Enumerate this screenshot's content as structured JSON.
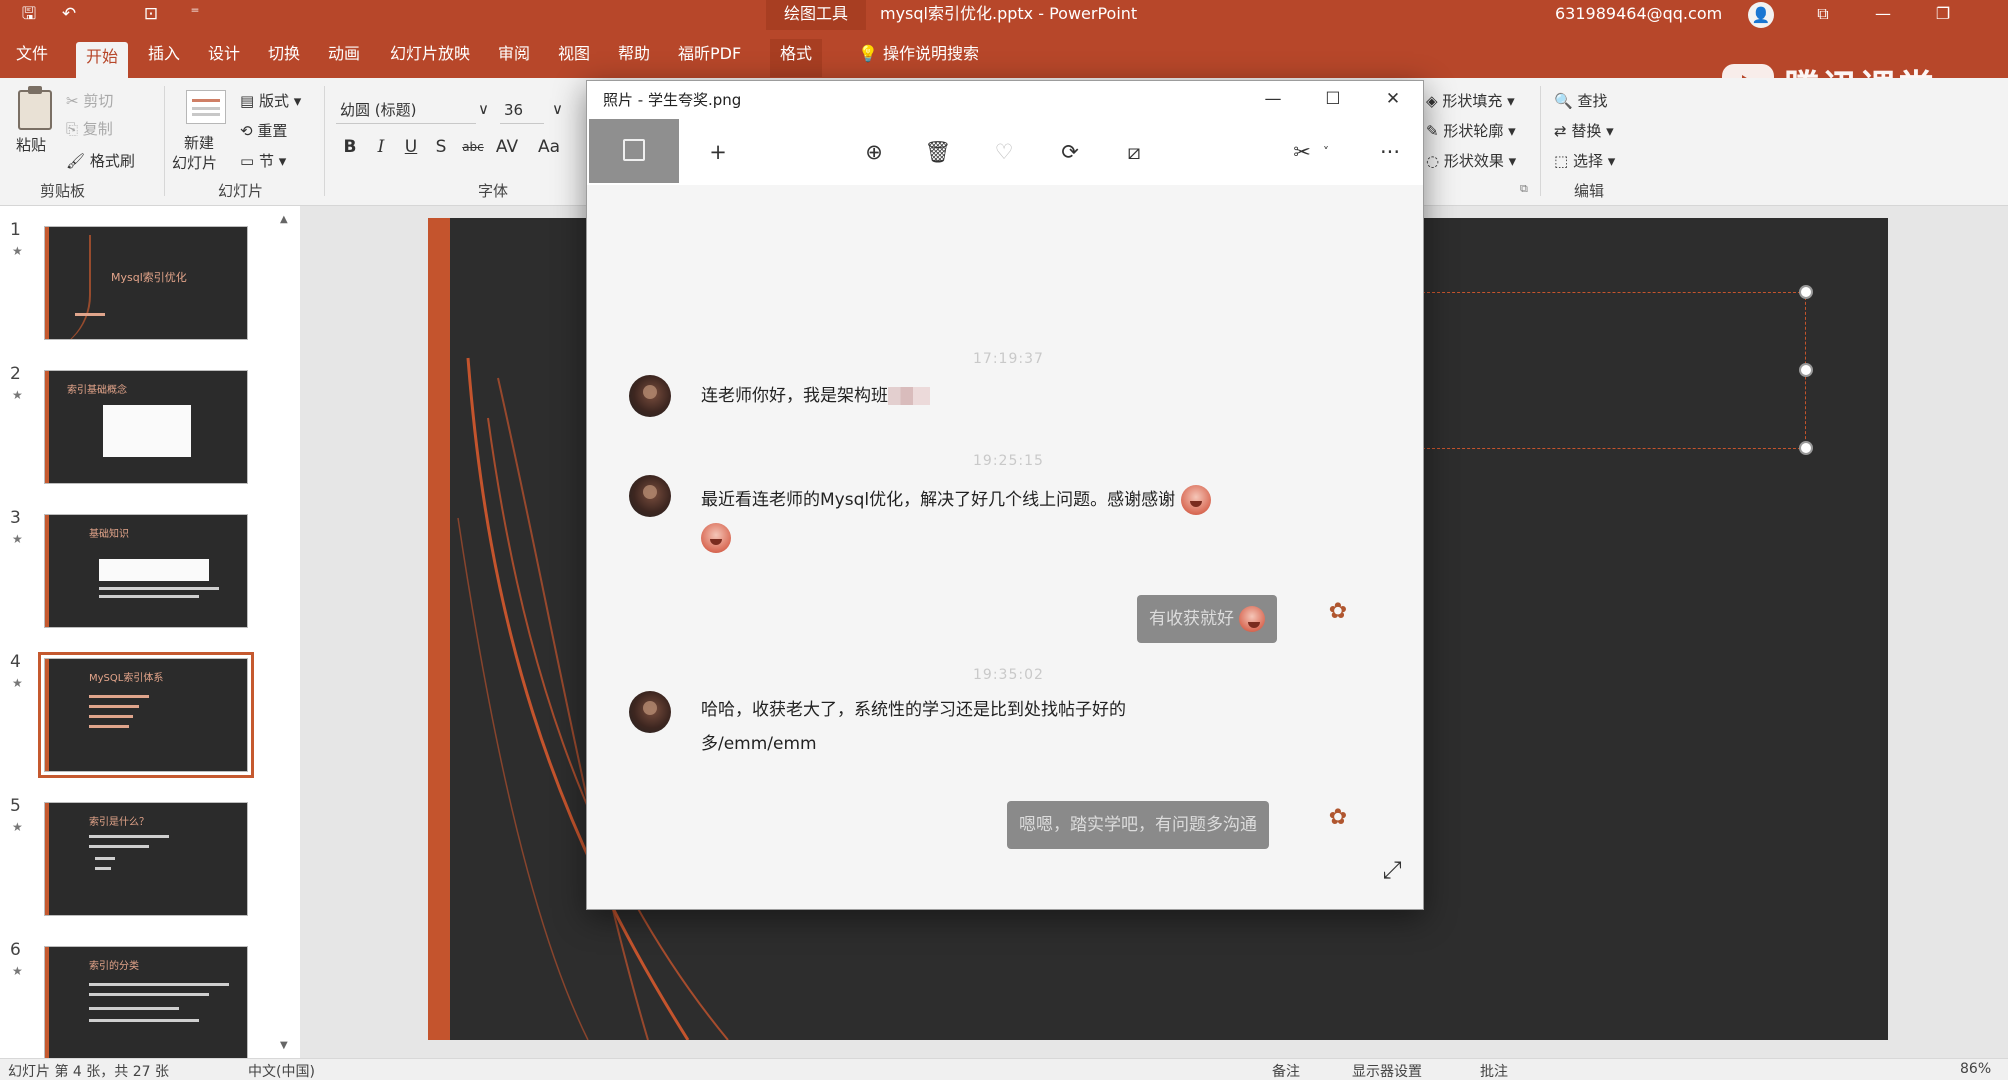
{
  "titlebar": {
    "context_tab": "绘图工具",
    "doc_title": "mysql索引优化.pptx  -  PowerPoint",
    "account": "631989464@qq.com",
    "window_buttons": [
      "—",
      "❐",
      "✕"
    ]
  },
  "tabs": [
    "文件",
    "开始",
    "插入",
    "设计",
    "切换",
    "动画",
    "幻灯片放映",
    "审阅",
    "视图",
    "帮助",
    "福昕PDF",
    "格式"
  ],
  "tab_search": "操作说明搜索",
  "watermark": "腾讯课堂",
  "ribbon": {
    "clipboard": {
      "paste": "粘贴",
      "cut": "剪切",
      "copy": "复制",
      "format_painter": "格式刷",
      "label": "剪贴板"
    },
    "slides": {
      "new_slide": "新建",
      "new_slide2": "幻灯片",
      "layout": "版式",
      "reset": "重置",
      "section": "节",
      "label": "幻灯片"
    },
    "font": {
      "family": "幼圆 (标题)",
      "size": "36",
      "bold": "B",
      "italic": "I",
      "underline": "U",
      "strike": "S",
      "abc": "abc",
      "spacing": "AV",
      "case": "Aa",
      "label": "字体"
    },
    "drawing": {
      "fill": "形状填充",
      "outline": "形状轮廓",
      "effects": "形状效果"
    },
    "editing": {
      "find": "查找",
      "replace": "替换",
      "select": "选择",
      "label": "编辑"
    }
  },
  "slides_panel": {
    "numbers": [
      "1",
      "2",
      "3",
      "4",
      "5",
      "6"
    ],
    "titles": [
      "Mysql索引优化",
      "索引基础概念",
      "基础知识",
      "MySQL索引体系",
      "索引是什么？",
      "索引的分类"
    ],
    "selected_index": 4
  },
  "statusbar": {
    "slide_info": "幻灯片 第 4 张，共 27 张",
    "language": "中文(中国)",
    "notes": "备注",
    "display": "显示器设置",
    "comments": "批注",
    "zoom": "86%"
  },
  "photo_window": {
    "title": "照片 - 学生夸奖.png",
    "controls": [
      "—",
      "☐",
      "✕"
    ],
    "tools": {
      "add": "+",
      "more": "···"
    }
  },
  "chat": {
    "ts1": "17:19:37",
    "msg1": "连老师你好，我是架构班",
    "ts2": "19:25:15",
    "msg2": "最近看连老师的Mysql优化，解决了好几个线上问题。感谢感谢",
    "reply1": "有收获就好",
    "ts3": "19:35:02",
    "msg3_line1": "哈哈，收获老大了，系统性的学习还是比到处找帖子好的",
    "msg3_line2": "多/emm/emm",
    "reply2": "嗯嗯，踏实学吧，有问题多沟通"
  }
}
